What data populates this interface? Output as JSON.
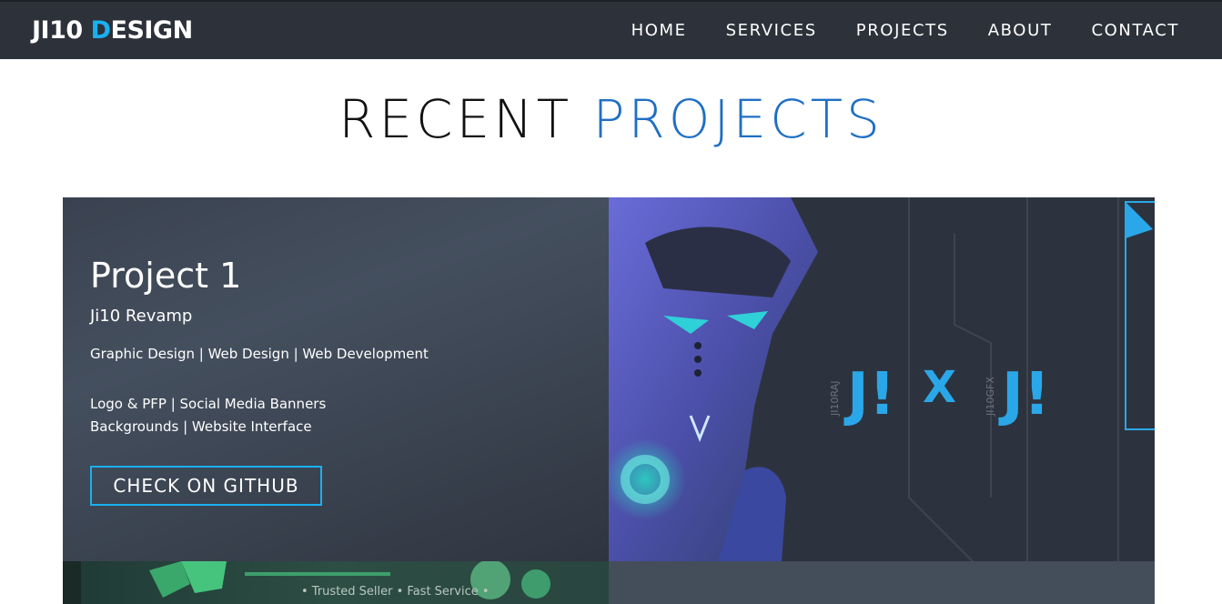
{
  "nav": {
    "logo_part1": "JI10 ",
    "logo_accent": "D",
    "logo_part2": "ESIGN",
    "links": [
      "HOME",
      "SERVICES",
      "PROJECTS",
      "ABOUT",
      "CONTACT"
    ]
  },
  "section": {
    "title_part1": "RECENT ",
    "title_part2": "PROJECTS"
  },
  "project": {
    "title": "Project 1",
    "subtitle": "Ji10 Revamp",
    "categories": "Graphic Design | Web Design | Web Development",
    "deliverables_line1": "Logo & PFP | Social Media Banners",
    "deliverables_line2": "Backgrounds | Website Interface",
    "cta_label": "CHECK ON GITHUB",
    "image_text": {
      "left_brand": "JI10RAJ",
      "right_brand": "JI10GFX",
      "mark_left": "J!",
      "mark_x": "X",
      "mark_right": "J!"
    }
  },
  "next_project": {
    "banner_text": "•  Trusted Seller  •  Fast Service  •"
  },
  "colors": {
    "nav_bg": "#2c313a",
    "accent_cyan": "#1ab0f0",
    "title_blue": "#1f6fc4"
  }
}
